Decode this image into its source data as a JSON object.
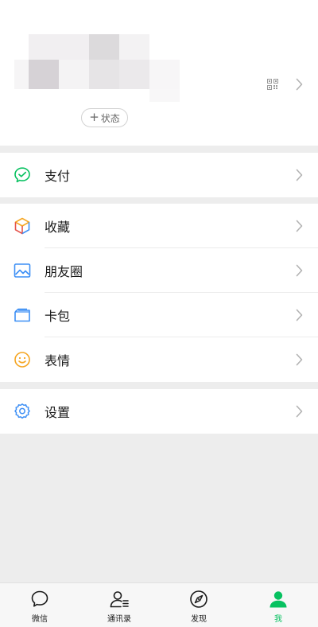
{
  "profile": {
    "status_label": "状态"
  },
  "menu": {
    "pay": "支付",
    "favorites": "收藏",
    "moments": "朋友圈",
    "cards": "卡包",
    "stickers": "表情",
    "settings": "设置"
  },
  "tabbar": {
    "chats": "微信",
    "contacts": "通讯录",
    "discover": "发现",
    "me": "我",
    "active": "me"
  },
  "colors": {
    "accent": "#07c160",
    "background": "#ededed"
  }
}
